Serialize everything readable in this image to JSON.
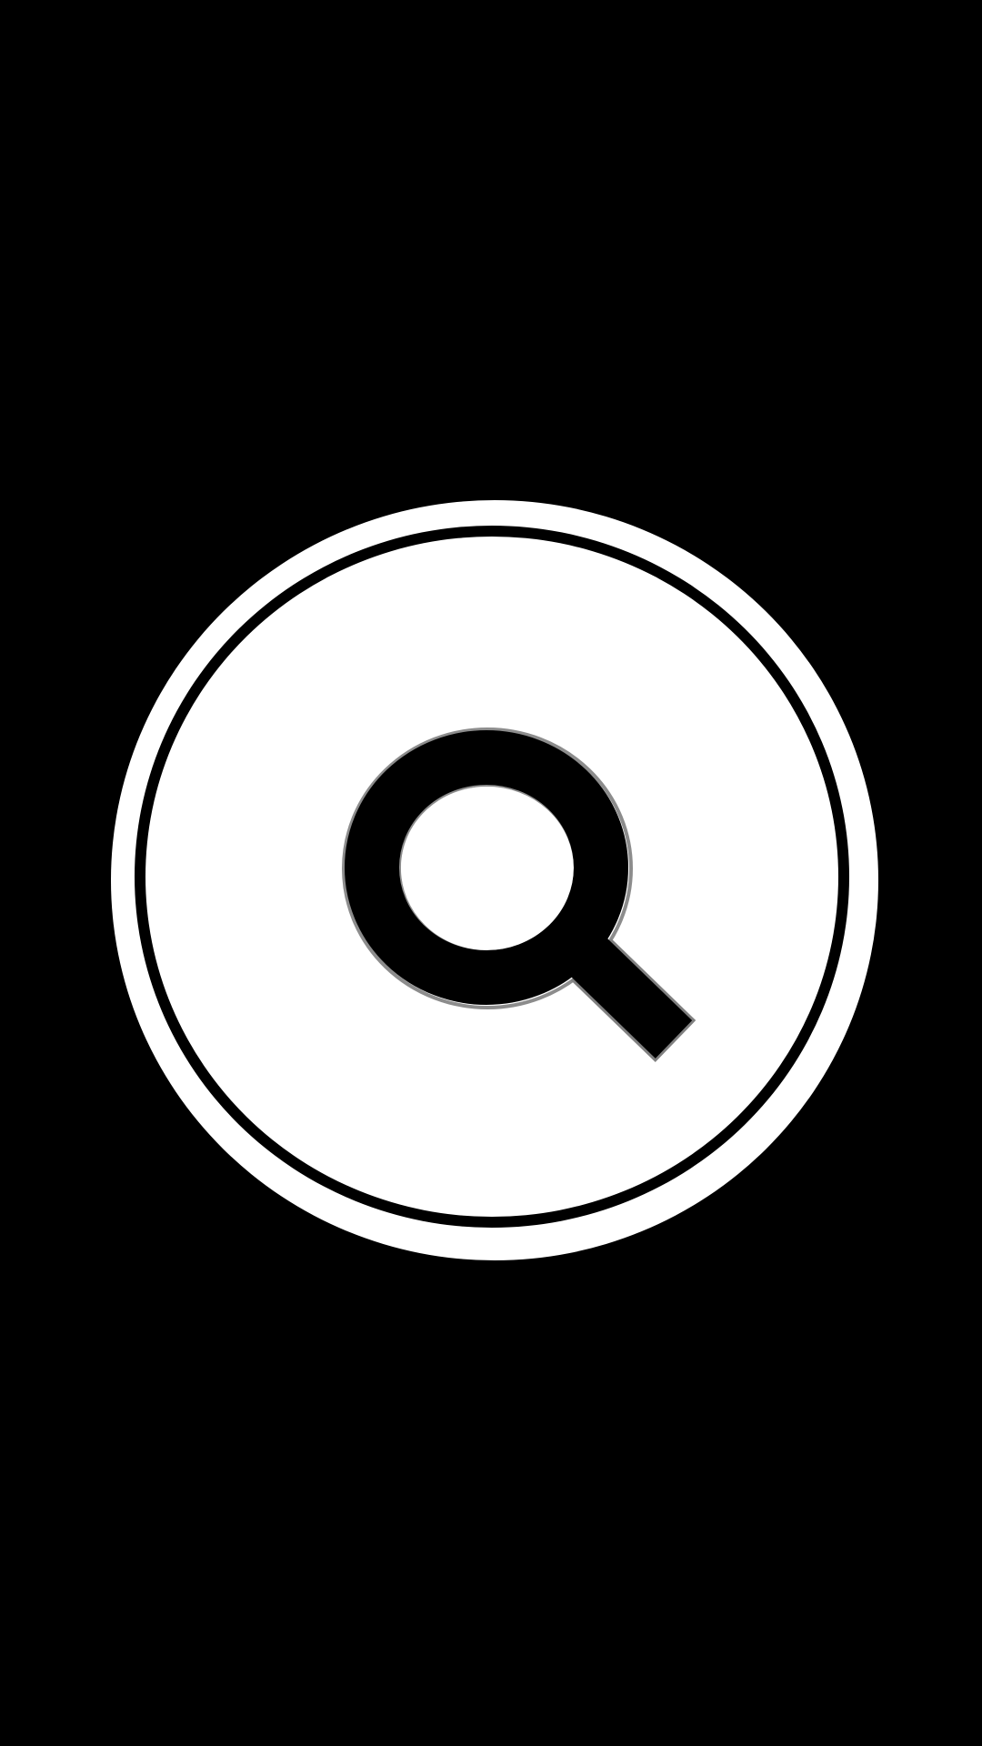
{
  "screen": {
    "background_color": "#000000",
    "accent_color": "#ffffff"
  },
  "search_button": {
    "icon": "magnifying-glass-icon",
    "icon_color": "#000000",
    "icon_shadow_color": "#808080"
  }
}
